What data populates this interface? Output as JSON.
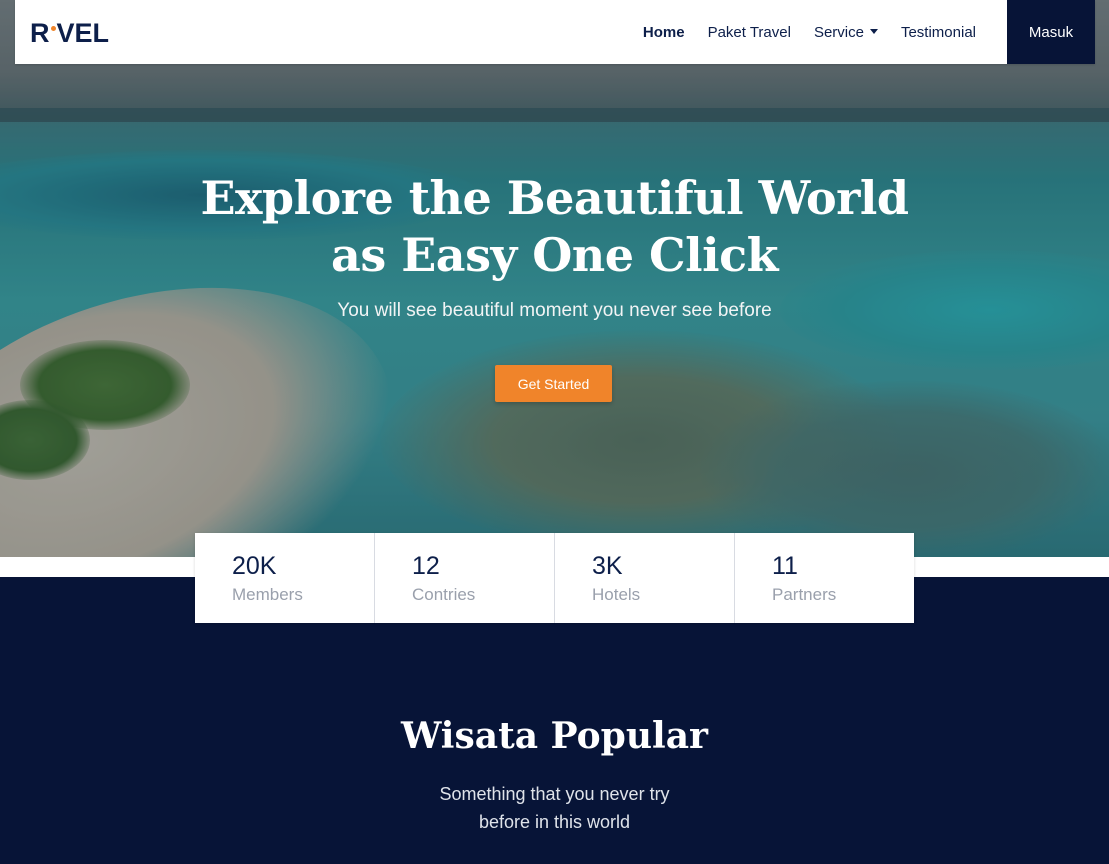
{
  "brand": {
    "logo_text_left": "R",
    "logo_text_right": "VEL"
  },
  "nav": {
    "items": [
      {
        "label": "Home",
        "active": true
      },
      {
        "label": "Paket Travel",
        "active": false
      },
      {
        "label": "Service",
        "active": false,
        "dropdown": true
      },
      {
        "label": "Testimonial",
        "active": false
      }
    ],
    "login_label": "Masuk"
  },
  "hero": {
    "title_line1": "Explore the Beautiful World",
    "title_line2": "as Easy One Click",
    "subtitle": "You will see beautiful moment you never see before",
    "cta_label": "Get Started"
  },
  "stats": [
    {
      "value": "20K",
      "label": "Members"
    },
    {
      "value": "12",
      "label": "Contries"
    },
    {
      "value": "3K",
      "label": "Hotels"
    },
    {
      "value": "11",
      "label": "Partners"
    }
  ],
  "popular": {
    "title": "Wisata Popular",
    "subtitle_line1": "Something that you never try",
    "subtitle_line2": "before in this world"
  },
  "colors": {
    "navy": "#071437",
    "accent": "#f0842a",
    "white": "#ffffff"
  }
}
